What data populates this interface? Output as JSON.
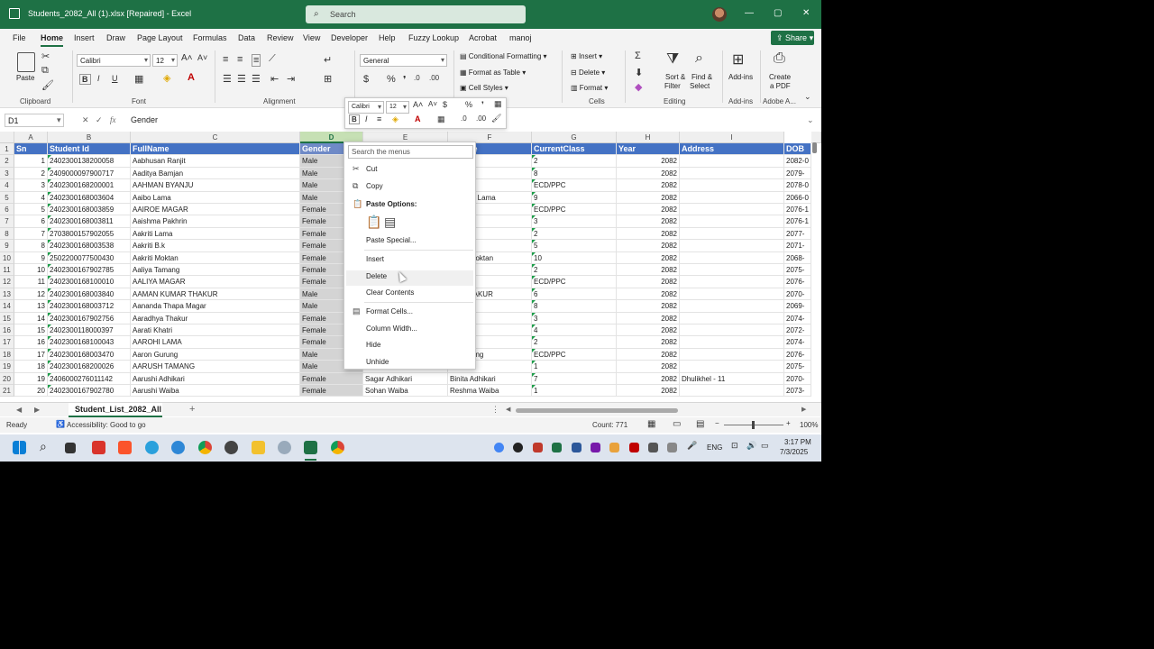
{
  "window": {
    "title": "Students_2082_All (1).xlsx [Repaired]  -  Excel",
    "search_placeholder": "Search",
    "min_label": "—",
    "max_label": "▢",
    "close_label": "✕"
  },
  "menu": {
    "items": [
      "File",
      "Home",
      "Insert",
      "Draw",
      "Page Layout",
      "Formulas",
      "Data",
      "Review",
      "View",
      "Developer",
      "Help",
      "Fuzzy Lookup",
      "Acrobat",
      "manoj"
    ],
    "active": "Home",
    "share_label": "Share"
  },
  "ribbon": {
    "paste": "Paste",
    "clipboard": "Clipboard",
    "font_name": "Calibri",
    "font_size": "12",
    "font_group": "Font",
    "alignment_group": "Alignment",
    "number_format": "General",
    "number_group": "Number",
    "conditional_formatting": "Conditional Formatting",
    "format_as_table": "Format as Table",
    "cell_styles": "Cell Styles",
    "styles_group": "Styles",
    "insert": "Insert",
    "delete": "Delete",
    "format": "Format",
    "cells_group": "Cells",
    "sort_filter_1": "Sort &",
    "sort_filter_2": "Filter",
    "find_select_1": "Find &",
    "find_select_2": "Select",
    "editing_group": "Editing",
    "addins": "Add-ins",
    "addins_group": "Add-ins",
    "create_pdf_1": "Create",
    "create_pdf_2": "a PDF",
    "adobe_group": "Adobe A..."
  },
  "formula_bar": {
    "name_box": "D1",
    "formula": "Gender"
  },
  "columns": [
    {
      "letter": "A",
      "selected": false
    },
    {
      "letter": "B",
      "selected": false
    },
    {
      "letter": "C",
      "selected": false
    },
    {
      "letter": "D",
      "selected": true
    },
    {
      "letter": "E",
      "selected": false
    },
    {
      "letter": "F",
      "selected": false
    },
    {
      "letter": "G",
      "selected": false
    },
    {
      "letter": "H",
      "selected": false
    },
    {
      "letter": "I",
      "selected": false
    }
  ],
  "header_row": [
    "Sn",
    "Student Id",
    "FullName",
    "Gender",
    "",
    "r Name",
    "CurrentClass",
    "Year",
    "Address",
    "DOB"
  ],
  "rows": [
    [
      "1",
      "2402300138200058",
      "Aabhusan  Ranjit",
      "Male",
      "",
      "",
      "2",
      "2082",
      "",
      "2082-0"
    ],
    [
      "2",
      "2409000097900717",
      "Aaditya Bamjan",
      "Male",
      "",
      "",
      "8",
      "2082",
      "",
      "2079-"
    ],
    [
      "3",
      "2402300168200001",
      "AAHMAN BYANJU",
      "Male",
      "",
      "YANJU",
      "ECD/PPC",
      "2082",
      "",
      "2078-0"
    ],
    [
      "4",
      "2402300168003604",
      "Aaibo Lama",
      "Male",
      "",
      "Tamang Lama",
      "9",
      "2082",
      "",
      "2066-0"
    ],
    [
      "5",
      "2402300168003859",
      "AAIROE MAGAR",
      "Female",
      "",
      "",
      "ECD/PPC",
      "2082",
      "",
      "2076-1"
    ],
    [
      "6",
      "2402300168003811",
      "Aaishma Pakhrin",
      "Female",
      "",
      "",
      "3",
      "2082",
      "",
      "2076-1"
    ],
    [
      "7",
      "2703800157902055",
      "Aakriti  Lama",
      "Female",
      "",
      "Lama",
      "2",
      "2082",
      "",
      "2077-"
    ],
    [
      "8",
      "2402300168003538",
      "Aakriti B.k",
      "Female",
      "",
      "Bk",
      "5",
      "2082",
      "",
      "2071-"
    ],
    [
      "9",
      "2502200077500430",
      "Aakriti Moktan",
      "Female",
      "",
      "Maya Moktan",
      "10",
      "2082",
      "",
      "2068-"
    ],
    [
      "10",
      "2402300167902785",
      "Aaliya  Tamang",
      "Female",
      "",
      "Tamang",
      "2",
      "2082",
      "",
      "2075-"
    ],
    [
      "11",
      "2402300168100010",
      "AALIYA MAGAR",
      "Female",
      "",
      "",
      "ECD/PPC",
      "2082",
      "",
      "2076-"
    ],
    [
      "12",
      "2402300168003840",
      "AAMAN KUMAR THAKUR",
      "Male",
      "",
      "EVI THAKUR",
      "6",
      "2082",
      "",
      "2070-"
    ],
    [
      "13",
      "2402300168003712",
      "Aananda  Thapa Magar",
      "Male",
      "",
      "urung",
      "8",
      "2082",
      "",
      "2069-"
    ],
    [
      "14",
      "2402300167902756",
      "Aaradhya  Thakur",
      "Female",
      "",
      "hakur",
      "3",
      "2082",
      "",
      "2074-"
    ],
    [
      "15",
      "2402300118000397",
      "Aarati Khatri",
      "Female",
      "",
      "",
      "4",
      "2082",
      "",
      "2072-"
    ],
    [
      "16",
      "2402300168100043",
      "AAROHI LAMA",
      "Female",
      "",
      "",
      "2",
      "2082",
      "",
      "2074-"
    ],
    [
      "17",
      "2402300168003470",
      "Aaron Gurung",
      "Male",
      "",
      "ya Gurung",
      "ECD/PPC",
      "2082",
      "",
      "2076-"
    ],
    [
      "18",
      "2402300168200026",
      "AARUSH TAMANG",
      "Male",
      "",
      "AGAR",
      "1",
      "2082",
      "",
      "2075-"
    ],
    [
      "19",
      "2406000276011142",
      "Aarushi Adhikari",
      "Female",
      "Sagar Adhikari",
      "Binita Adhikari",
      "7",
      "2082",
      "Dhulikhel - 11",
      "2070-"
    ],
    [
      "20",
      "2402300167902780",
      "Aarushi Waiba",
      "Female",
      "Sohan Waiba",
      "Reshma Waiba",
      "1",
      "2082",
      "",
      "2073-"
    ]
  ],
  "mini_toolbar": {
    "font": "Calibri",
    "size": "12"
  },
  "context_menu": {
    "search_placeholder": "Search the menus",
    "cut": "Cut",
    "copy": "Copy",
    "paste_options": "Paste Options:",
    "paste_special": "Paste Special...",
    "insert": "Insert",
    "delete": "Delete",
    "clear_contents": "Clear Contents",
    "format_cells": "Format Cells...",
    "column_width": "Column Width...",
    "hide": "Hide",
    "unhide": "Unhide"
  },
  "sheet": {
    "tab_name": "Student_List_2082_All",
    "add_label": "+"
  },
  "status": {
    "ready": "Ready",
    "accessibility": "Accessibility: Good to go",
    "count": "Count: 771",
    "zoom": "100%"
  },
  "taskbar": {
    "language": "ENG",
    "time": "3:17 PM",
    "date": "7/3/2025"
  }
}
